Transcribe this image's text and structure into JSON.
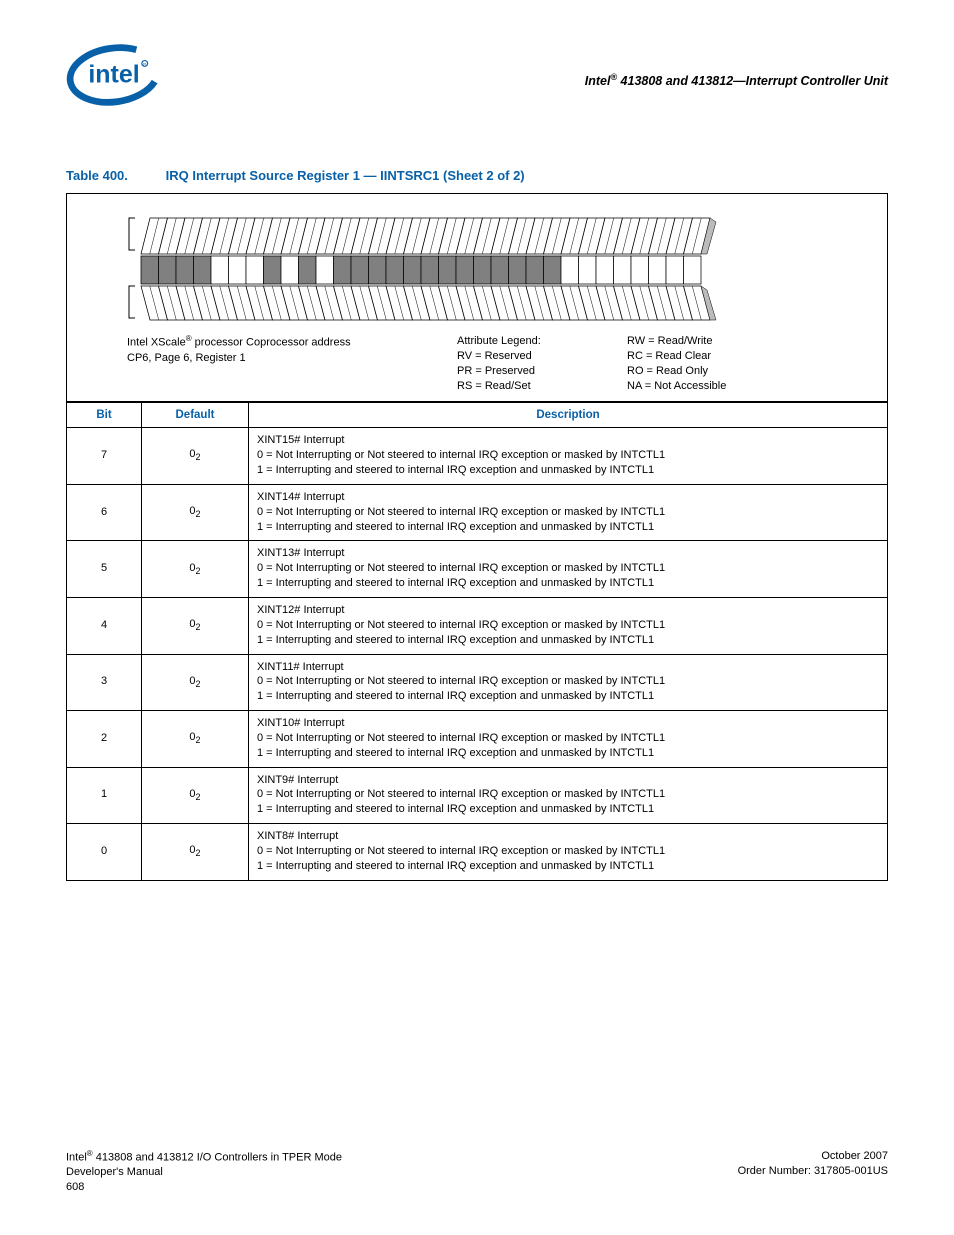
{
  "header": {
    "right_title_pre": "Intel",
    "right_title_post": " 413808 and 413812—Interrupt Controller Unit"
  },
  "caption": {
    "label": "Table 400.",
    "title": "IRQ Interrupt Source Register 1 — IINTSRC1 (Sheet 2 of 2)"
  },
  "diagram": {
    "address_line1_pre": "Intel XScale",
    "address_line1_post": " processor Coprocessor address",
    "address_line2": "CP6, Page 6, Register 1",
    "legend_title": "Attribute Legend:",
    "legend": [
      "RV = Reserved",
      "PR = Preserved",
      "RS = Read/Set"
    ],
    "legend_right": [
      "RW = Read/Write",
      "RC = Read Clear",
      "RO = Read Only",
      "NA = Not Accessible"
    ],
    "shaded_bits": [
      31,
      30,
      29,
      28,
      24,
      22,
      20,
      19,
      18,
      17,
      16,
      15,
      14,
      13,
      12,
      11,
      10,
      9,
      8
    ]
  },
  "table": {
    "headers": {
      "bit": "Bit",
      "default": "Default",
      "description": "Description"
    },
    "rows": [
      {
        "bit": "7",
        "default_base": "0",
        "default_sub": "2",
        "title": "XINT15# Interrupt",
        "v0": "0 =  Not Interrupting or Not steered to internal IRQ exception or masked by INTCTL1",
        "v1": "1 =  Interrupting and steered to internal IRQ exception and unmasked by INTCTL1"
      },
      {
        "bit": "6",
        "default_base": "0",
        "default_sub": "2",
        "title": "XINT14# Interrupt",
        "v0": "0 =  Not Interrupting or Not steered to internal IRQ exception or masked by INTCTL1",
        "v1": "1 =  Interrupting and steered to internal IRQ exception and unmasked by INTCTL1"
      },
      {
        "bit": "5",
        "default_base": "0",
        "default_sub": "2",
        "title": "XINT13# Interrupt",
        "v0": "0 =  Not Interrupting or Not steered to internal IRQ exception or masked by INTCTL1",
        "v1": "1 =  Interrupting and steered to internal IRQ exception and unmasked by INTCTL1"
      },
      {
        "bit": "4",
        "default_base": "0",
        "default_sub": "2",
        "title": "XINT12# Interrupt",
        "v0": "0 =  Not Interrupting or Not steered to internal IRQ exception or masked by INTCTL1",
        "v1": "1 =  Interrupting and steered to internal IRQ exception and unmasked by INTCTL1"
      },
      {
        "bit": "3",
        "default_base": "0",
        "default_sub": "2",
        "title": "XINT11# Interrupt",
        "v0": "0 =  Not Interrupting or Not steered to internal IRQ exception or masked by INTCTL1",
        "v1": "1 =  Interrupting and steered to internal IRQ exception and unmasked by INTCTL1"
      },
      {
        "bit": "2",
        "default_base": "0",
        "default_sub": "2",
        "title": "XINT10# Interrupt",
        "v0": "0 =  Not Interrupting or Not steered to internal IRQ exception or masked by INTCTL1",
        "v1": "1 =  Interrupting and steered to internal IRQ exception and unmasked by INTCTL1"
      },
      {
        "bit": "1",
        "default_base": "0",
        "default_sub": "2",
        "title": "XINT9# Interrupt",
        "v0": "0 =  Not Interrupting or Not steered to internal IRQ exception or masked by INTCTL1",
        "v1": "1 =  Interrupting and steered to internal IRQ exception and unmasked by INTCTL1"
      },
      {
        "bit": "0",
        "default_base": "0",
        "default_sub": "2",
        "title": "XINT8# Interrupt",
        "v0": "0 =  Not Interrupting or Not steered to internal IRQ exception or masked by INTCTL1",
        "v1": "1 =  Interrupting and steered to internal IRQ exception and unmasked by INTCTL1"
      }
    ]
  },
  "footer": {
    "left_line1_pre": "Intel",
    "left_line1_post": " 413808 and 413812 I/O Controllers in TPER Mode",
    "left_line2": "Developer's Manual",
    "left_line3": "608",
    "right_line1": "October 2007",
    "right_line2": "Order Number: 317805-001US"
  }
}
